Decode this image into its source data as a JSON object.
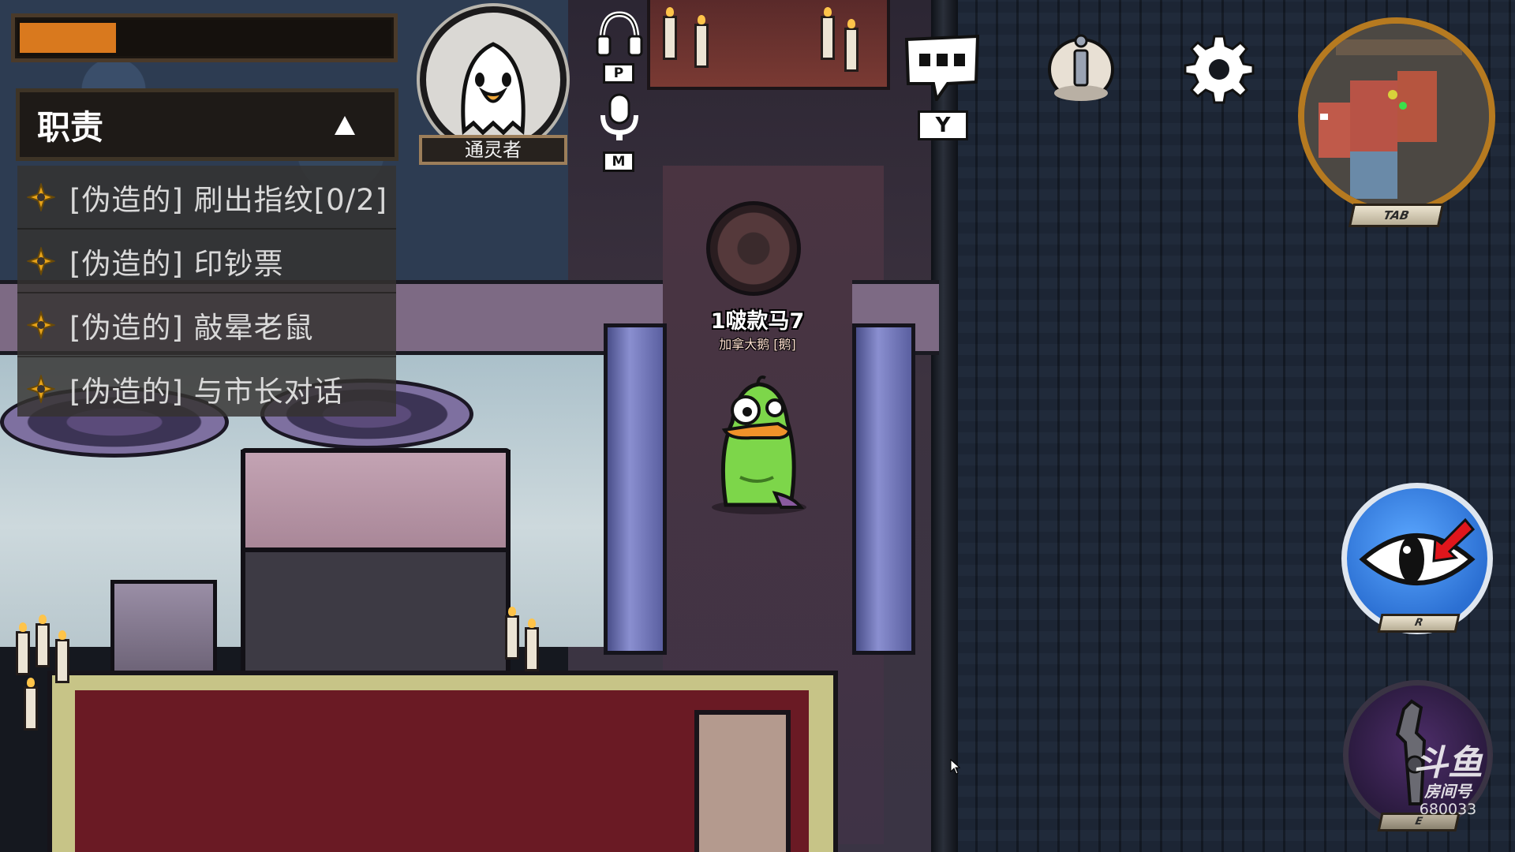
{
  "hud": {
    "progress": {
      "value": 0.26,
      "fill_color": "#d9791e"
    },
    "tasks": {
      "title": "职责",
      "toggle_icon": "triangle-up-icon",
      "task_icon": "crosshair-target-icon",
      "items": [
        {
          "label": "[伪造的] 刷出指纹[0/2]"
        },
        {
          "label": "[伪造的] 印钞票"
        },
        {
          "label": "[伪造的] 敲晕老鼠"
        },
        {
          "label": "[伪造的] 与市长对话"
        }
      ]
    },
    "role": {
      "name": "通灵者",
      "icon": "ghost-goose-portrait"
    },
    "voice": {
      "headphones": {
        "icon": "headphones-icon",
        "key": "P"
      },
      "microphone": {
        "icon": "microphone-icon",
        "key": "M"
      }
    },
    "chat": {
      "icon": "chat-bubble-icon",
      "key": "Y"
    },
    "info": {
      "icon": "info-icon"
    },
    "settings": {
      "icon": "gear-icon"
    },
    "minimap": {
      "key": "TAB"
    },
    "ability": {
      "icon": "eye-icon",
      "key": "R"
    },
    "sabotage": {
      "icon": "wrench-icon",
      "key": "E"
    }
  },
  "player": {
    "name": "1啵款马7",
    "role_tag": "加拿大鹅 [鹅]",
    "body_color": "#7dd64a"
  },
  "watermark": {
    "logo": "斗鱼",
    "label": "房间号",
    "room": "680033"
  }
}
